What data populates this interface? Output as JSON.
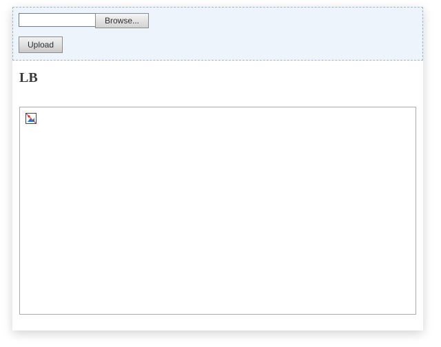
{
  "uploadPanel": {
    "fileValue": "",
    "browseLabel": "Browse...",
    "uploadLabel": "Upload"
  },
  "content": {
    "title": "LB"
  }
}
